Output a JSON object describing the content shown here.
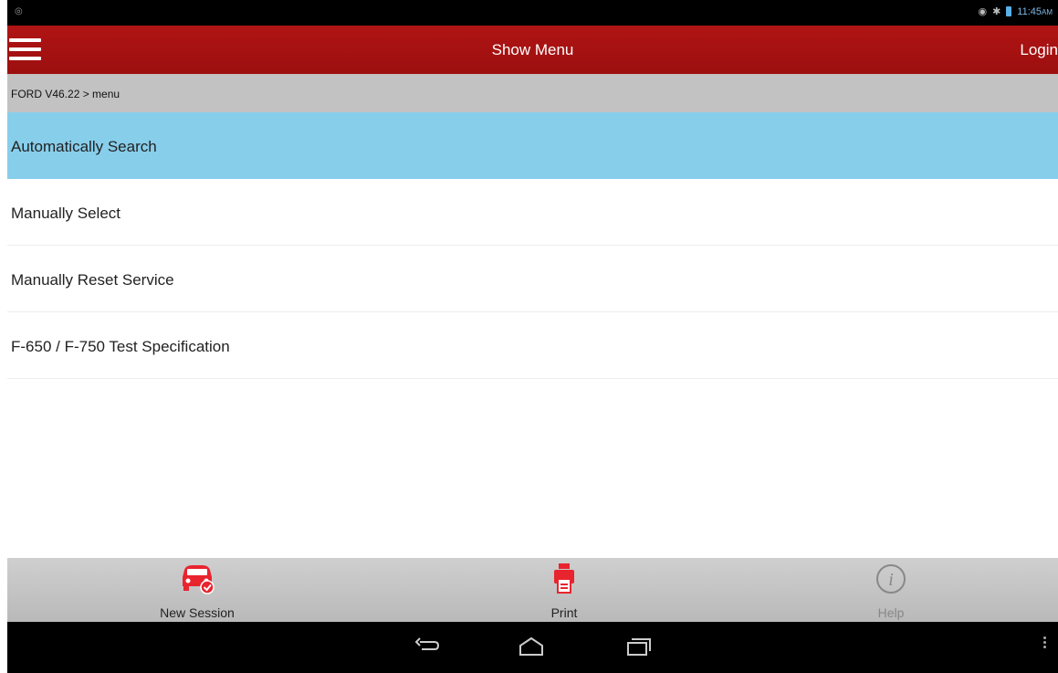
{
  "status_bar": {
    "time": "11:45",
    "ampm": "AM"
  },
  "app_bar": {
    "title": "Show Menu",
    "login_label": "Login"
  },
  "breadcrumb": {
    "text": "FORD V46.22 > menu"
  },
  "menu": {
    "items": [
      {
        "label": "Automatically Search",
        "selected": true
      },
      {
        "label": "Manually Select",
        "selected": false
      },
      {
        "label": "Manually Reset Service",
        "selected": false
      },
      {
        "label": "F-650 / F-750 Test Specification",
        "selected": false
      }
    ]
  },
  "toolbar": {
    "new_session": {
      "label": "New Session",
      "icon": "car-icon"
    },
    "print": {
      "label": "Print",
      "icon": "printer-icon"
    },
    "help": {
      "label": "Help",
      "icon": "info-icon"
    }
  },
  "colors": {
    "app_bar": "#a81212",
    "selected_row": "#87ceeb",
    "accent_icon": "#e8242e",
    "breadcrumb_bg": "#c2c2c2"
  }
}
